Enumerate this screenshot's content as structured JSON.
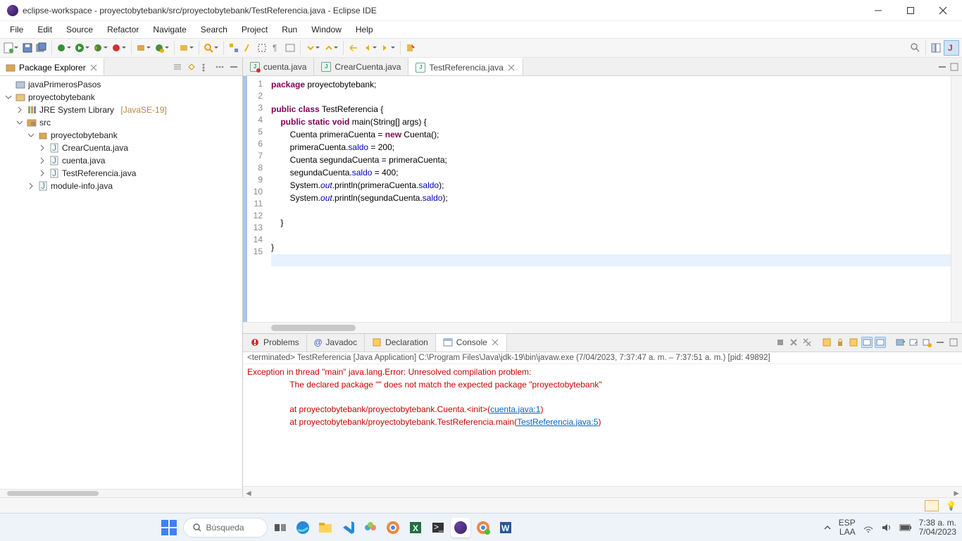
{
  "window": {
    "title": "eclipse-workspace - proyectobytebank/src/proyectobytebank/TestReferencia.java - Eclipse IDE"
  },
  "menu": {
    "items": [
      "File",
      "Edit",
      "Source",
      "Refactor",
      "Navigate",
      "Search",
      "Project",
      "Run",
      "Window",
      "Help"
    ]
  },
  "package_explorer": {
    "title": "Package Explorer",
    "tree": {
      "closed_project": "javaPrimerosPasos",
      "open_project": "proyectobytebank",
      "jre": "JRE System Library",
      "jre_ver": "[JavaSE-19]",
      "src": "src",
      "pkg": "proyectobytebank",
      "files": [
        "CrearCuenta.java",
        "cuenta.java",
        "TestReferencia.java"
      ],
      "module": "module-info.java"
    }
  },
  "editor_tabs": {
    "t1": "cuenta.java",
    "t2": "CrearCuenta.java",
    "t3": "TestReferencia.java"
  },
  "code": {
    "l1a": "package",
    "l1b": " proyectobytebank;",
    "l3a": "public",
    "l3b": " class",
    "l3c": " TestReferencia {",
    "l4a": "    public",
    "l4b": " static",
    "l4c": " void",
    "l4d": " main(String[] args) {",
    "l5a": "        Cuenta primeraCuenta = ",
    "l5b": "new",
    "l5c": " Cuenta();",
    "l6a": "        primeraCuenta.",
    "l6b": "saldo",
    "l6c": " = 200;",
    "l7a": "        Cuenta segundaCuenta = primeraCuenta;",
    "l8a": "        segundaCuenta.",
    "l8b": "saldo",
    "l8c": " = 400;",
    "l9a": "        System.",
    "l9b": "out",
    "l9c": ".println(primeraCuenta.",
    "l9d": "saldo",
    "l9e": ");",
    "l10a": "        System.",
    "l10b": "out",
    "l10c": ".println(segundaCuenta.",
    "l10d": "saldo",
    "l10e": ");",
    "l12": "    }",
    "l14": "}",
    "lines": [
      "1",
      "2",
      "3",
      "4",
      "5",
      "6",
      "7",
      "8",
      "9",
      "10",
      "11",
      "12",
      "13",
      "14",
      "15"
    ]
  },
  "bottom": {
    "tabs": {
      "problems": "Problems",
      "javadoc": "Javadoc",
      "declaration": "Declaration",
      "console": "Console"
    },
    "console_desc": "<terminated> TestReferencia [Java Application] C:\\Program Files\\Java\\jdk-19\\bin\\javaw.exe  (7/04/2023, 7:37:47 a. m. – 7:37:51 a. m.) [pid: 49892]",
    "c1": "Exception in thread \"main\" java.lang.Error: Unresolved compilation problem: ",
    "c2": "\tThe declared package \"\" does not match the expected package \"proyectobytebank\"",
    "c3a": "\tat proyectobytebank/proyectobytebank.Cuenta.<init>(",
    "c3b": "cuenta.java:1",
    "c3c": ")",
    "c4a": "\tat proyectobytebank/proyectobytebank.TestReferencia.main(",
    "c4b": "TestReferencia.java:5",
    "c4c": ")"
  },
  "taskbar": {
    "search_placeholder": "Búsqueda",
    "lang1": "ESP",
    "lang2": "LAA",
    "time": "7:38 a. m.",
    "date": "7/04/2023"
  }
}
